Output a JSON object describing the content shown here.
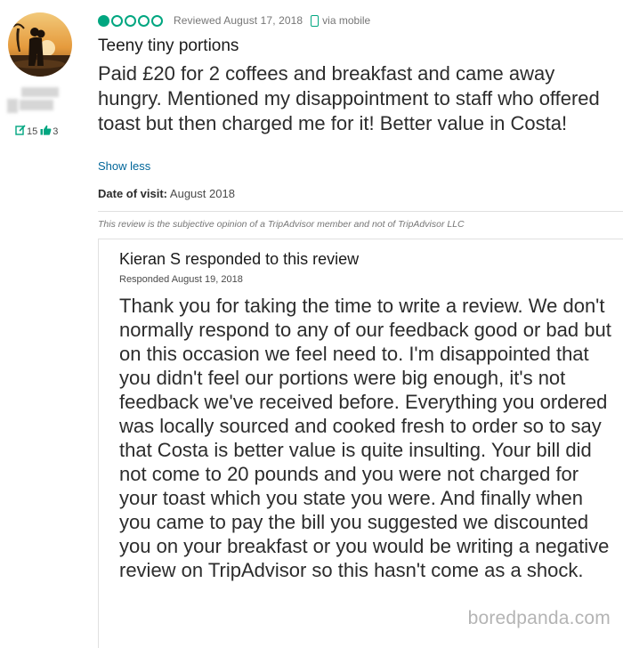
{
  "review": {
    "rating": {
      "value": 1,
      "max": 5,
      "color": "#00a680"
    },
    "date_text": "Reviewed August 17, 2018",
    "via_text": "via mobile",
    "title": "Teeny tiny portions",
    "body": "Paid £20 for 2 coffees and breakfast and came away hungry. Mentioned my disappointment to staff who offered toast but then charged me for it! Better value in Costa!",
    "show_less": "Show less",
    "visit_label": "Date of visit:",
    "visit_value": "August 2018",
    "disclaimer": "This review is the subjective opinion of a TripAdvisor member and not of TripAdvisor LLC"
  },
  "reviewer": {
    "reviews_count": "15",
    "helpful_count": "3"
  },
  "response": {
    "title": "Kieran S responded to this review",
    "date_text": "Responded August 19, 2018",
    "body": "Thank you for taking the time to write a review. We don't normally respond to any of our feedback good or bad but on this occasion we feel need to. I'm disappointed that you didn't feel our portions were big enough, it's not feedback we've received before. Everything you ordered was locally sourced and cooked fresh to order so to say that Costa is better value is quite insulting. Your bill did not come to 20 pounds and you were not charged for your toast which you state you were. And finally when you came to pay the bill you suggested we discounted you on your breakfast or you would be writing a negative review on TripAdvisor so this hasn't come as a shock."
  },
  "watermark": "boredpanda.com",
  "colors": {
    "accent": "#00a680",
    "link": "#006699"
  }
}
